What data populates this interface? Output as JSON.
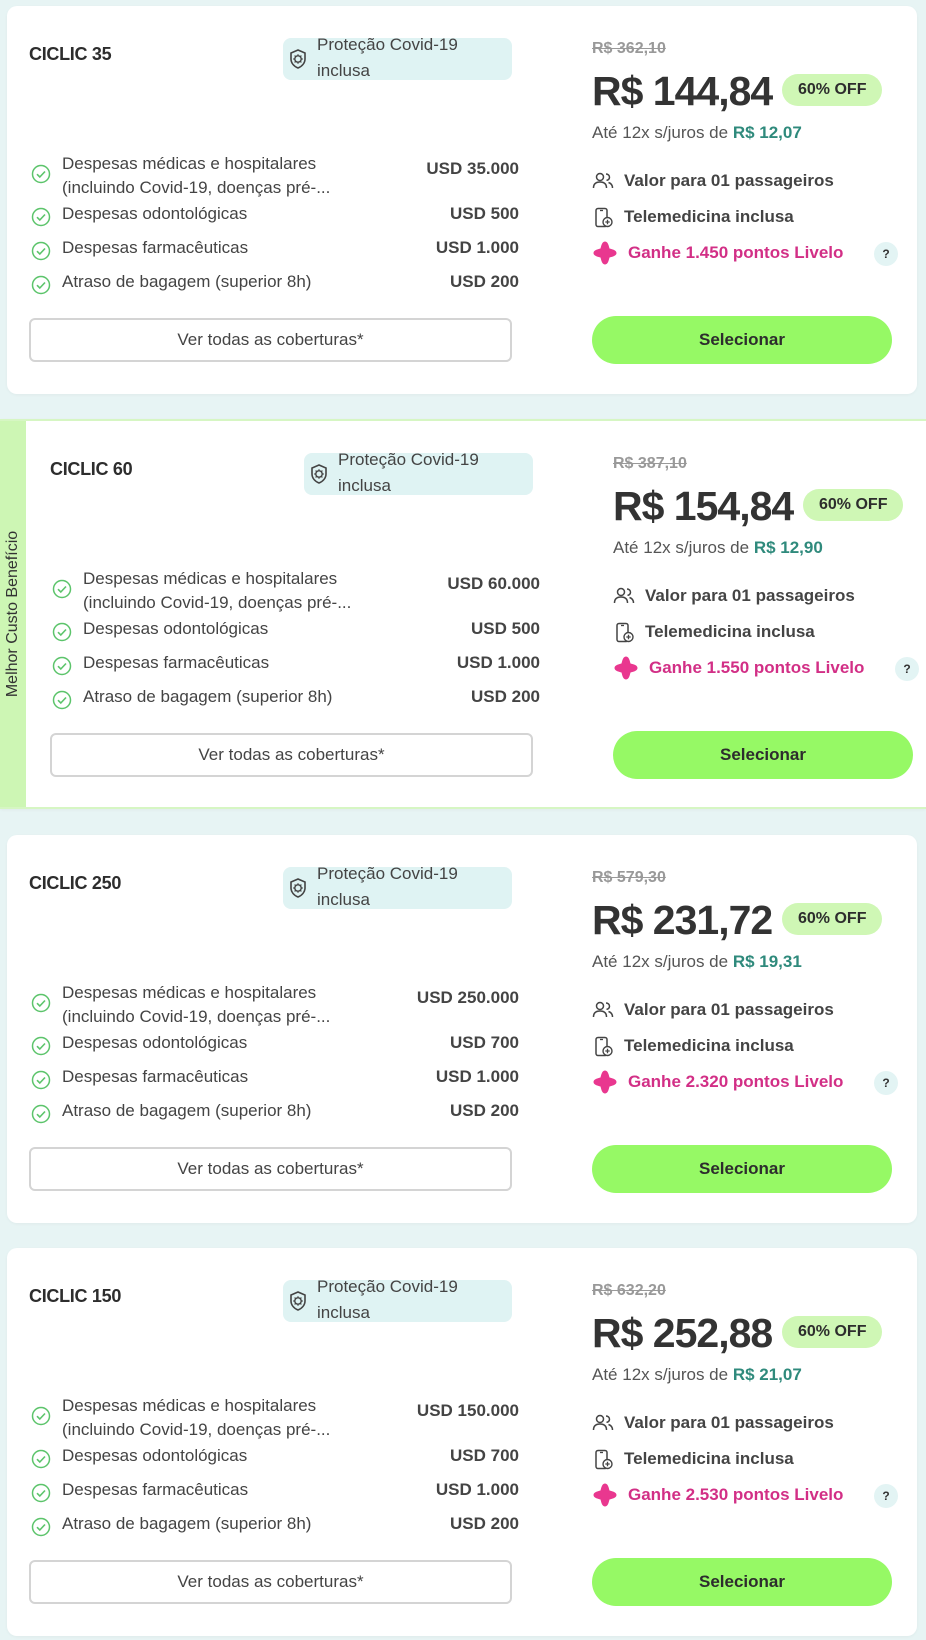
{
  "featured_label": "Melhor Custo Benefício",
  "colors": {
    "accent_green": "#96f965",
    "livelo_pink": "#d22f86",
    "teal_text": "#2f8a7c",
    "badge_bg": "#dff3f3"
  },
  "plans": [
    {
      "name": "CICLIC 35",
      "covid_badge": "Proteção Covid-19 inclusa",
      "coverages": [
        {
          "label": "Despesas médicas e hospitalares (incluindo Covid-19, doenças pré-...",
          "value": "USD 35.000"
        },
        {
          "label": "Despesas odontológicas",
          "value": "USD 500"
        },
        {
          "label": "Despesas farmacêuticas",
          "value": "USD 1.000"
        },
        {
          "label": "Atraso de bagagem (superior 8h)",
          "value": "USD 200"
        }
      ],
      "see_all": "Ver todas as coberturas*",
      "old_price": "R$ 362,10",
      "price": "R$ 144,84",
      "discount": "60% OFF",
      "installments_prefix": "Até 12x s/juros de ",
      "installments_value": "R$ 12,07",
      "passengers": "Valor para 01 passageiros",
      "telemedicine": "Telemedicina inclusa",
      "livelo": "Ganhe 1.450 pontos Livelo",
      "help": "?",
      "select": "Selecionar"
    },
    {
      "name": "CICLIC 60",
      "covid_badge": "Proteção Covid-19 inclusa",
      "coverages": [
        {
          "label": "Despesas médicas e hospitalares (incluindo Covid-19, doenças pré-...",
          "value": "USD 60.000"
        },
        {
          "label": "Despesas odontológicas",
          "value": "USD 500"
        },
        {
          "label": "Despesas farmacêuticas",
          "value": "USD 1.000"
        },
        {
          "label": "Atraso de bagagem (superior 8h)",
          "value": "USD 200"
        }
      ],
      "see_all": "Ver todas as coberturas*",
      "old_price": "R$ 387,10",
      "price": "R$ 154,84",
      "discount": "60% OFF",
      "installments_prefix": "Até 12x s/juros de ",
      "installments_value": "R$ 12,90",
      "passengers": "Valor para 01 passageiros",
      "telemedicine": "Telemedicina inclusa",
      "livelo": "Ganhe 1.550 pontos Livelo",
      "help": "?",
      "select": "Selecionar"
    },
    {
      "name": "CICLIC 250",
      "covid_badge": "Proteção Covid-19 inclusa",
      "coverages": [
        {
          "label": "Despesas médicas e hospitalares (incluindo Covid-19, doenças pré-...",
          "value": "USD 250.000"
        },
        {
          "label": "Despesas odontológicas",
          "value": "USD 700"
        },
        {
          "label": "Despesas farmacêuticas",
          "value": "USD 1.000"
        },
        {
          "label": "Atraso de bagagem (superior 8h)",
          "value": "USD 200"
        }
      ],
      "see_all": "Ver todas as coberturas*",
      "old_price": "R$ 579,30",
      "price": "R$ 231,72",
      "discount": "60% OFF",
      "installments_prefix": "Até 12x s/juros de ",
      "installments_value": "R$ 19,31",
      "passengers": "Valor para 01 passageiros",
      "telemedicine": "Telemedicina inclusa",
      "livelo": "Ganhe 2.320 pontos Livelo",
      "help": "?",
      "select": "Selecionar"
    },
    {
      "name": "CICLIC 150",
      "covid_badge": "Proteção Covid-19 inclusa",
      "coverages": [
        {
          "label": "Despesas médicas e hospitalares (incluindo Covid-19, doenças pré-...",
          "value": "USD 150.000"
        },
        {
          "label": "Despesas odontológicas",
          "value": "USD 700"
        },
        {
          "label": "Despesas farmacêuticas",
          "value": "USD 1.000"
        },
        {
          "label": "Atraso de bagagem (superior 8h)",
          "value": "USD 200"
        }
      ],
      "see_all": "Ver todas as coberturas*",
      "old_price": "R$ 632,20",
      "price": "R$ 252,88",
      "discount": "60% OFF",
      "installments_prefix": "Até 12x s/juros de ",
      "installments_value": "R$ 21,07",
      "passengers": "Valor para 01 passageiros",
      "telemedicine": "Telemedicina inclusa",
      "livelo": "Ganhe 2.530 pontos Livelo",
      "help": "?",
      "select": "Selecionar"
    }
  ]
}
